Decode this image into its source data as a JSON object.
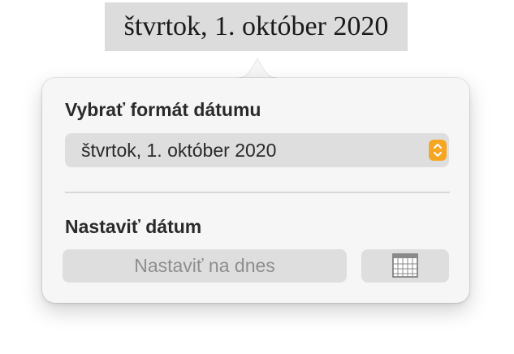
{
  "document": {
    "selected_date_text": "štvrtok, 1. október 2020"
  },
  "popover": {
    "format_section_title": "Vybrať formát dátumu",
    "format_select_value": "štvrtok, 1. október 2020",
    "stepper_icon": "up-down-chevron-icon",
    "date_section_title": "Nastaviť dátum",
    "today_button_label": "Nastaviť na dnes",
    "calendar_icon": "calendar-grid-icon"
  },
  "colors": {
    "accent": "#f5a623",
    "highlight": "#dcdcdc",
    "popover_bg": "#f6f6f6",
    "control_bg": "#dedede"
  }
}
